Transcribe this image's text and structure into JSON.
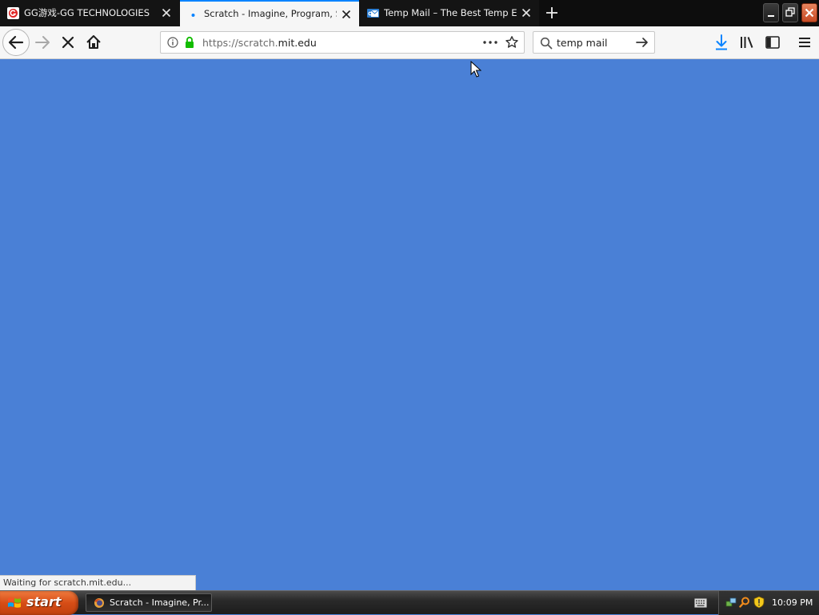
{
  "browser": {
    "tabs": [
      {
        "title": "GG游戏-GG TECHNOLOGIES",
        "favicon": "gg-logo-icon",
        "active": false
      },
      {
        "title": "Scratch - Imagine, Program, Share",
        "favicon": "loading-dot-icon",
        "active": true
      },
      {
        "title": "Temp Mail – The Best Temp Email Service",
        "favicon": "temp-mail-icon",
        "active": false
      }
    ],
    "url": {
      "prefix": "https://scratch.",
      "host": "mit.edu"
    },
    "search": {
      "value": "temp mail"
    },
    "status_text": "Waiting for scratch.mit.edu..."
  },
  "colors": {
    "page_background": "#4a80d6",
    "accent": "#0a84ff",
    "lock_green": "#12bc00",
    "download_blue": "#0a84ff"
  },
  "taskbar": {
    "start_label": "start",
    "task_item": "Scratch - Imagine, Pr...",
    "clock": "10:09 PM"
  }
}
